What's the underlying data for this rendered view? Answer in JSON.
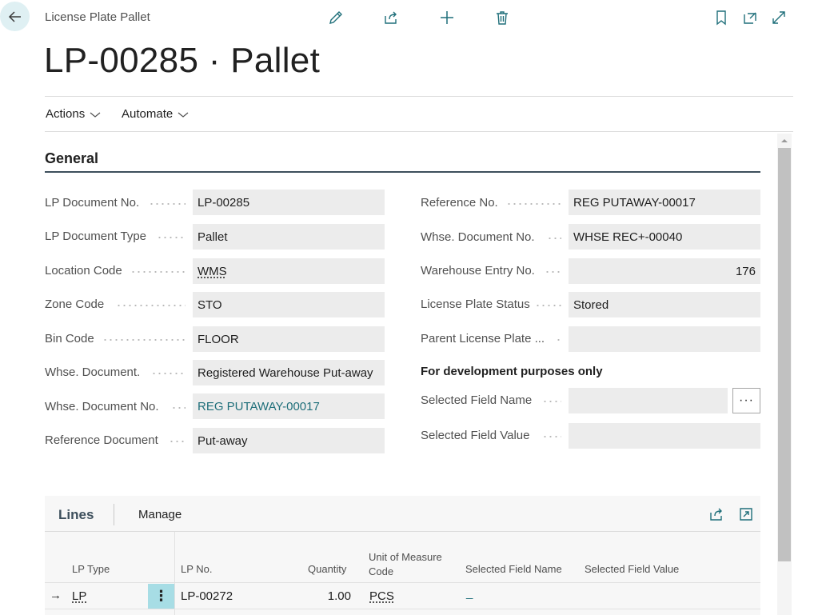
{
  "header": {
    "breadcrumb": "License Plate Pallet",
    "title": "LP-00285 · Pallet"
  },
  "menu": {
    "actions": "Actions",
    "automate": "Automate"
  },
  "general": {
    "heading": "General",
    "left_fields": [
      {
        "label": "LP Document No.",
        "value": "LP-00285"
      },
      {
        "label": "LP Document Type",
        "value": "Pallet"
      },
      {
        "label": "Location Code",
        "value": "WMS"
      },
      {
        "label": "Zone Code",
        "value": "STO"
      },
      {
        "label": "Bin Code",
        "value": "FLOOR"
      },
      {
        "label": "Whse. Document.",
        "value": "Registered Warehouse Put-away"
      },
      {
        "label": "Whse. Document No.",
        "value": "REG PUTAWAY-00017"
      },
      {
        "label": "Reference Document",
        "value": "Put-away"
      }
    ],
    "right_fields": [
      {
        "label": "Reference No.",
        "value": "REG PUTAWAY-00017"
      },
      {
        "label": "Whse. Document No.",
        "value": "WHSE REC+-00040"
      },
      {
        "label": "Warehouse Entry No.",
        "value": "176"
      },
      {
        "label": "License Plate Status",
        "value": "Stored"
      },
      {
        "label": "Parent License Plate ...",
        "value": ""
      }
    ],
    "dev_heading": "For development purposes only",
    "dev_fields": [
      {
        "label": "Selected Field Name",
        "value": ""
      },
      {
        "label": "Selected Field Value",
        "value": ""
      }
    ],
    "assist_button": "···"
  },
  "lines": {
    "tab_lines": "Lines",
    "tab_manage": "Manage",
    "columns": {
      "lp_type": "LP Type",
      "lp_no": "LP No.",
      "quantity": "Quantity",
      "uom_line1": "Unit of Measure",
      "uom_line2": "Code",
      "sel_field_name": "Selected Field Name",
      "sel_field_value": "Selected Field Value"
    },
    "rows": [
      {
        "arrow": "→",
        "lp_type": "LP",
        "row_menu": "⋮",
        "lp_no": "LP-00272",
        "quantity": "1.00",
        "uom": "PCS",
        "sel_field_name": "_",
        "sel_field_value": ""
      }
    ]
  },
  "colors": {
    "accent": "#1f6f7a",
    "back_button_bg": "#dff0f3",
    "selected_row_menu": "#a7dde5",
    "section_underline": "#3d4f5c"
  },
  "icons": [
    "back-arrow-icon",
    "edit-icon",
    "share-icon",
    "add-icon",
    "delete-icon",
    "bookmark-icon",
    "open-new-window-icon",
    "expand-icon",
    "chevron-down-icon",
    "share-lines-icon",
    "expand-lines-icon"
  ]
}
